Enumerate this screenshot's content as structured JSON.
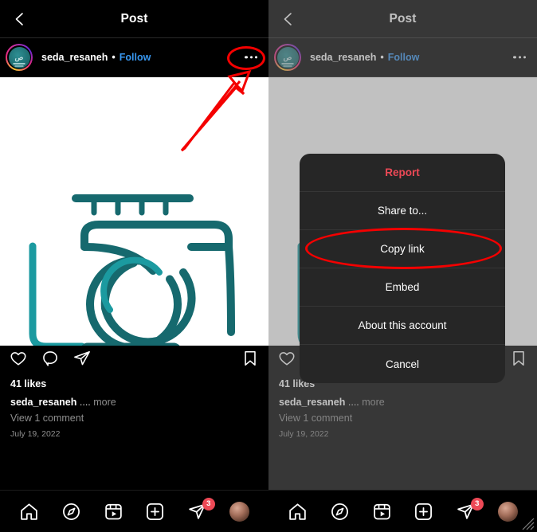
{
  "app": {
    "name": "instagram"
  },
  "left_panel": {
    "topbar": {
      "back_icon": "chevron-left-icon",
      "title": "Post"
    },
    "user_row": {
      "username": "seda_resaneh",
      "separator": "•",
      "follow_label": "Follow",
      "more_icon": "three-dots-icon",
      "avatar_glyph": "ص"
    },
    "post_image": {
      "alt": "teal-calligraphy-logo"
    },
    "actions": {
      "like_icon": "heart-icon",
      "comment_icon": "comment-bubble-icon",
      "share_icon": "paper-plane-icon",
      "save_icon": "bookmark-icon"
    },
    "meta": {
      "likes": "41 likes",
      "caption_user": "seda_resaneh",
      "caption_dots": "....",
      "caption_more": "more",
      "view_comments": "View 1 comment",
      "date": "July 19, 2022"
    }
  },
  "right_panel": {
    "topbar": {
      "back_icon": "chevron-left-icon",
      "title": "Post"
    },
    "user_row": {
      "username": "seda_resaneh",
      "separator": "•",
      "follow_label": "Follow",
      "more_icon": "three-dots-icon",
      "avatar_glyph": "ص"
    },
    "meta": {
      "likes": "41 likes",
      "caption_user": "seda_resaneh",
      "caption_dots": "....",
      "caption_more": "more",
      "view_comments": "View 1 comment",
      "date": "July 19, 2022"
    }
  },
  "action_sheet": {
    "items": [
      {
        "label": "Report",
        "style": "destructive"
      },
      {
        "label": "Share to...",
        "style": "normal"
      },
      {
        "label": "Copy link",
        "style": "normal"
      },
      {
        "label": "Embed",
        "style": "normal"
      },
      {
        "label": "About this account",
        "style": "normal"
      },
      {
        "label": "Cancel",
        "style": "normal"
      }
    ]
  },
  "annotations": {
    "highlight_color": "#f40000",
    "ellipse_more_button": "red-ellipse-around-more-button",
    "ellipse_copy_link": "red-ellipse-around-copy-link",
    "arrow": "red-arrow-pointing-to-more-button"
  },
  "bottom_nav": {
    "items": [
      {
        "icon": "home-icon",
        "badge": ""
      },
      {
        "icon": "compass-explore-icon",
        "badge": ""
      },
      {
        "icon": "reels-icon",
        "badge": ""
      },
      {
        "icon": "plus-square-icon",
        "badge": ""
      },
      {
        "icon": "activity-send-icon",
        "badge": "3"
      },
      {
        "icon": "profile-avatar",
        "badge": ""
      }
    ]
  },
  "window": {
    "resize_grip": "resize-grip-icon"
  }
}
